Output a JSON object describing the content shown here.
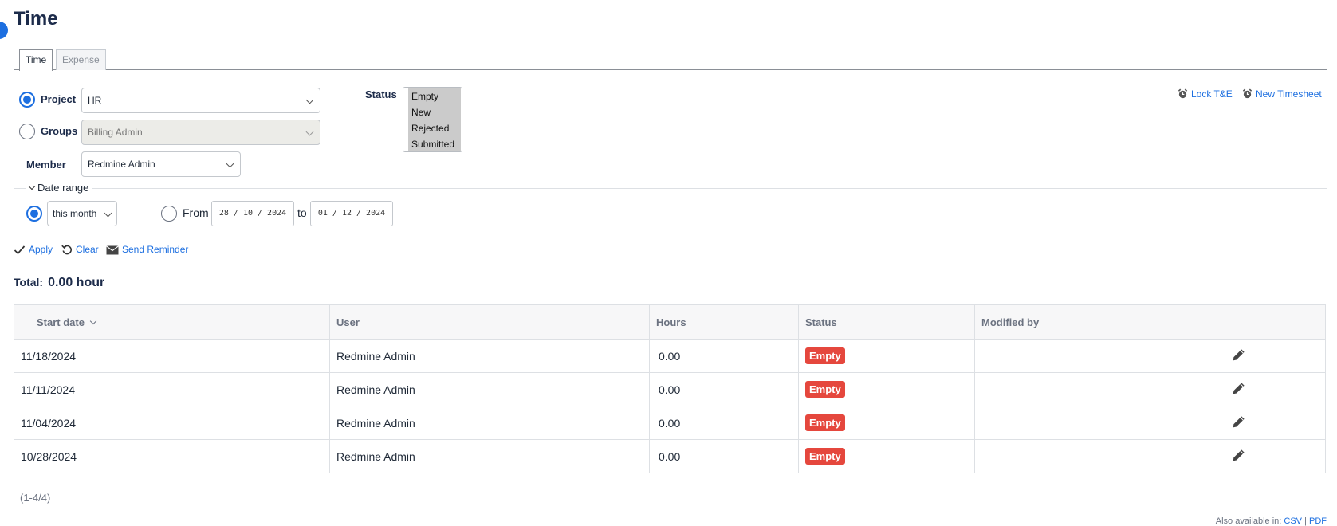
{
  "page": {
    "title": "Time"
  },
  "tabs": [
    {
      "label": "Time",
      "active": true
    },
    {
      "label": "Expense",
      "active": false
    }
  ],
  "filters": {
    "project": {
      "label": "Project",
      "value": "HR",
      "selected": true
    },
    "groups": {
      "label": "Groups",
      "value": "Billing Admin",
      "selected": false
    },
    "member": {
      "label": "Member",
      "value": "Redmine Admin"
    },
    "status": {
      "label": "Status",
      "options": [
        "Empty",
        "New",
        "Rejected",
        "Submitted"
      ]
    }
  },
  "top_actions": {
    "lock": "Lock T&E",
    "new_timesheet": "New Timesheet"
  },
  "date_range": {
    "legend": "Date range",
    "period": "this month",
    "from_label": "From",
    "from": "28 / 10 / 2024",
    "to_label": "to",
    "to": "01 / 12 / 2024"
  },
  "actions": {
    "apply": "Apply",
    "clear": "Clear",
    "reminder": "Send Reminder"
  },
  "total": {
    "label": "Total:",
    "value": "0.00 hour"
  },
  "table": {
    "columns": [
      "Start date",
      "User",
      "Hours",
      "Status",
      "Modified by",
      ""
    ],
    "rows": [
      {
        "start_date": "11/18/2024",
        "user": "Redmine Admin",
        "hours": "0.00",
        "status": "Empty",
        "modified_by": ""
      },
      {
        "start_date": "11/11/2024",
        "user": "Redmine Admin",
        "hours": "0.00",
        "status": "Empty",
        "modified_by": ""
      },
      {
        "start_date": "11/04/2024",
        "user": "Redmine Admin",
        "hours": "0.00",
        "status": "Empty",
        "modified_by": ""
      },
      {
        "start_date": "10/28/2024",
        "user": "Redmine Admin",
        "hours": "0.00",
        "status": "Empty",
        "modified_by": ""
      }
    ]
  },
  "pagination": "(1-4/4)",
  "also_available": {
    "label": "Also available in:",
    "csv": "CSV",
    "sep": " | ",
    "pdf": "PDF"
  },
  "colors": {
    "accent": "#1d6fe0",
    "status_empty": "#e5473d",
    "title": "#1c2b4a"
  }
}
